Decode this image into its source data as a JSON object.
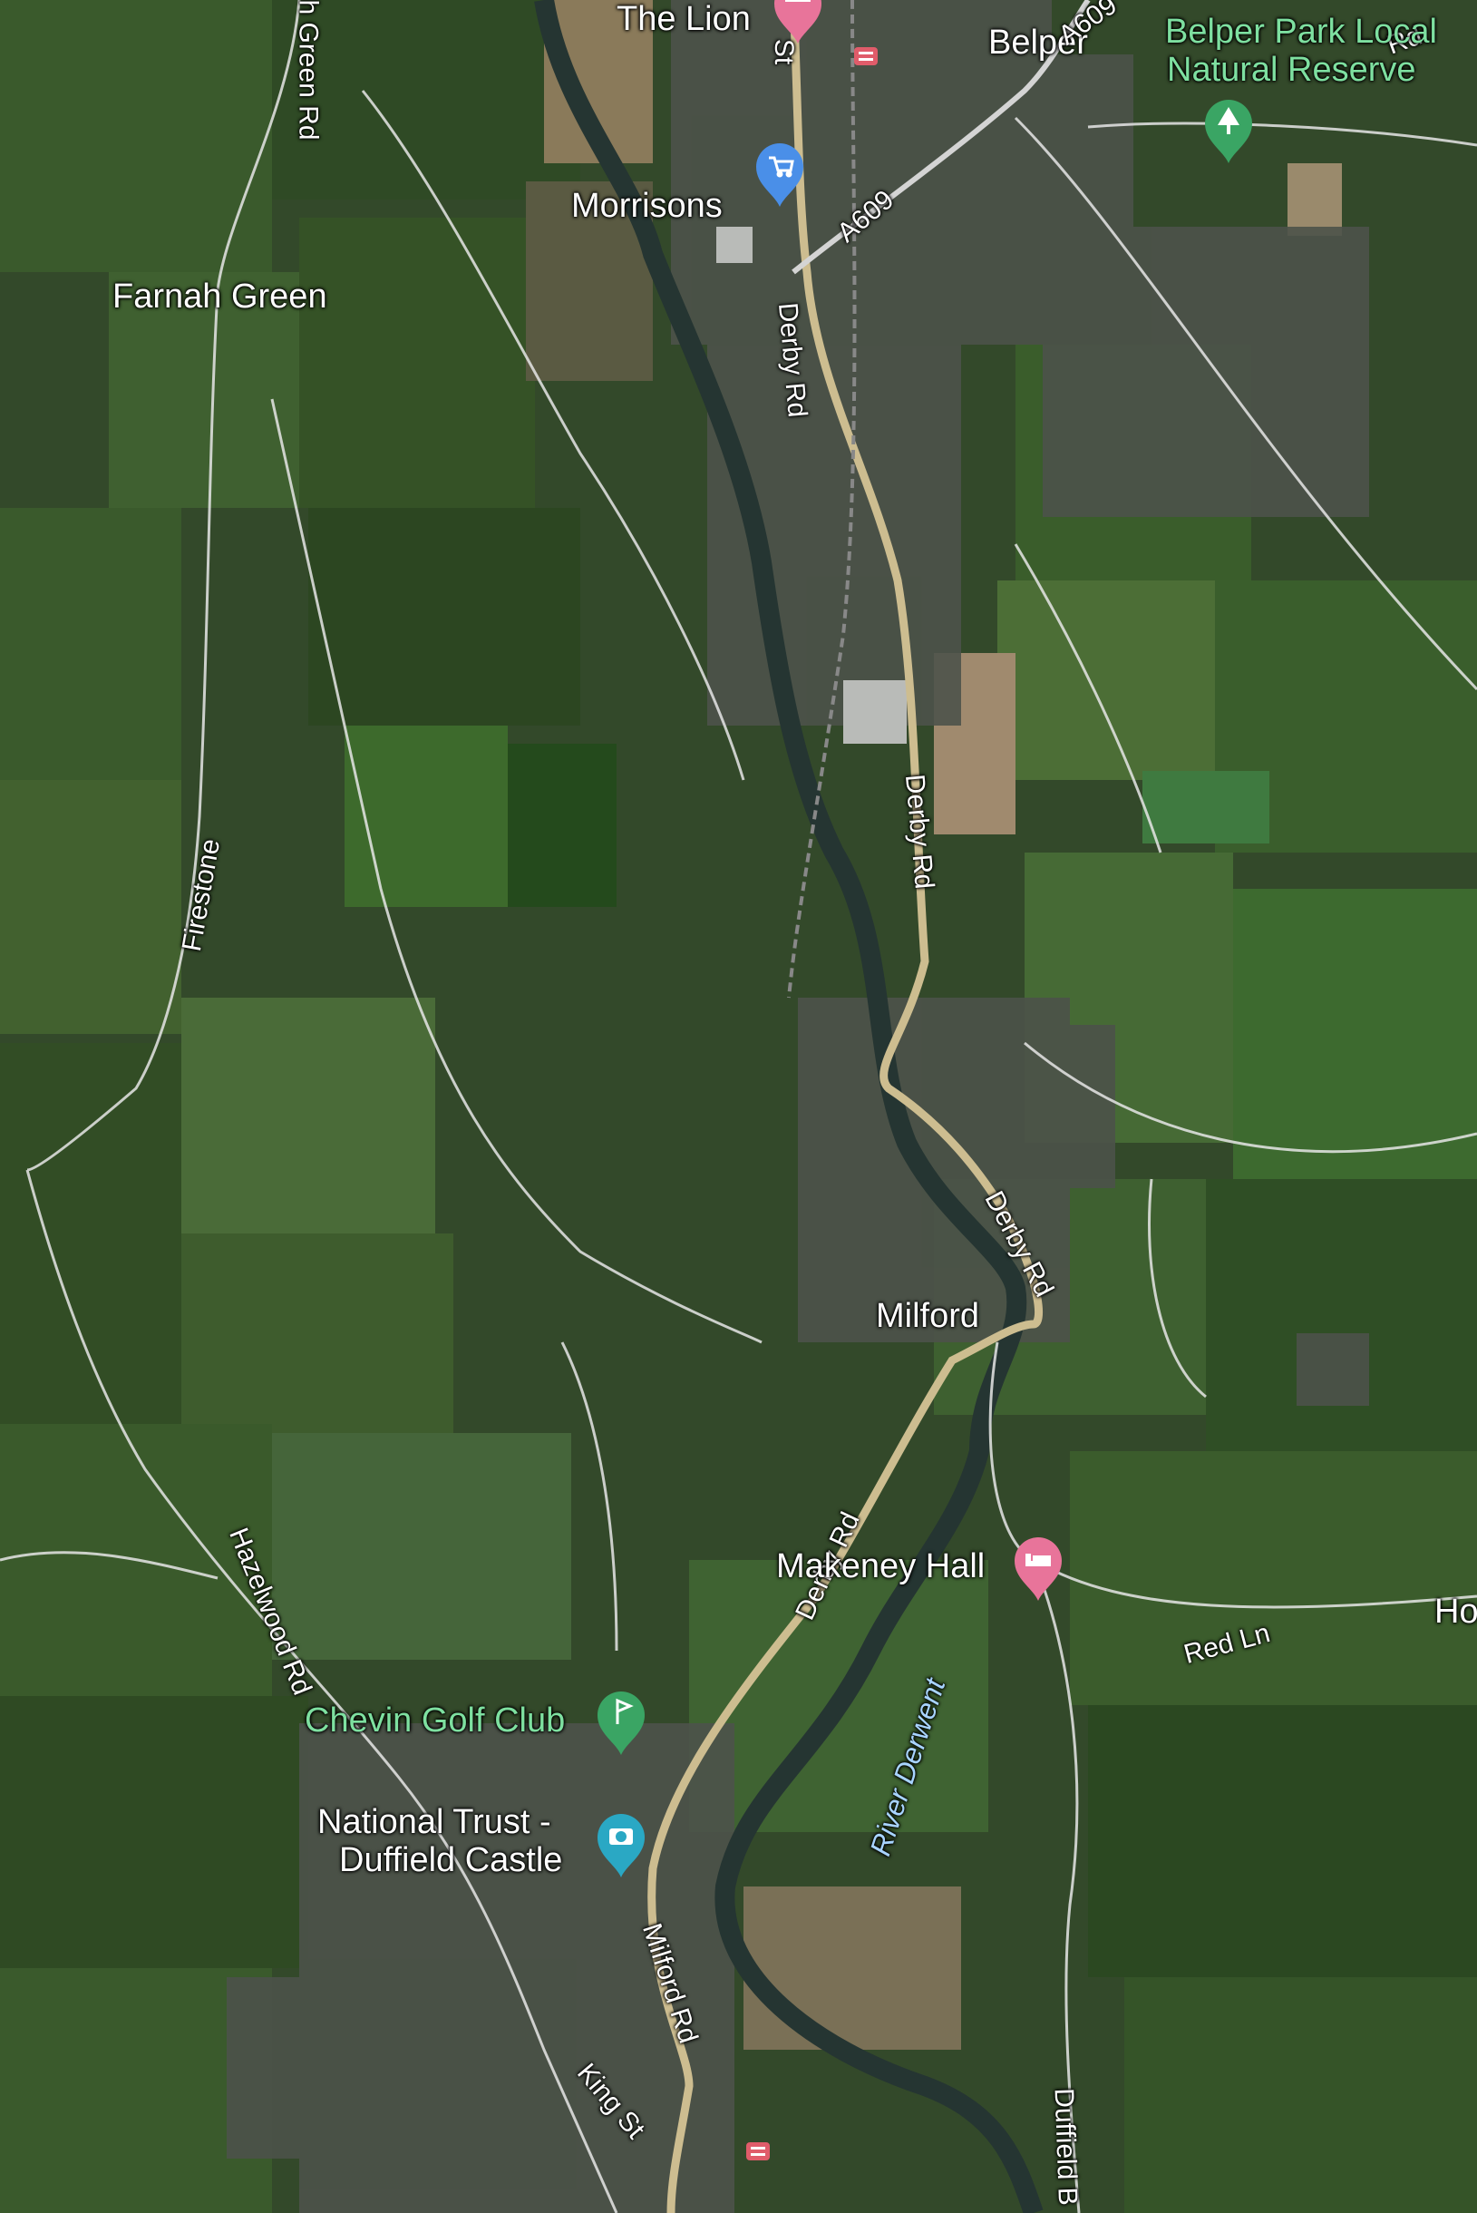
{
  "map": {
    "labels": {
      "the_lion": "The Lion",
      "morrisons": "Morrisons",
      "belper": "Belper",
      "belper_park": "Belper Park Local Natural Reserve",
      "belper_park_line1": "Belper Park Local",
      "belper_park_line2": "Natural Reserve",
      "farnah_green": "Farnah Green",
      "farnah_green_rd": "h Green Rd",
      "a609_1": "A609",
      "a609_2": "A609",
      "derby_rd_1": "Derby Rd",
      "derby_rd_2": "Derby Rd",
      "derby_rd_3": "Derby Rd",
      "derby_rd_4": "Derby Rd",
      "firestone": "Firestone",
      "milford": "Milford",
      "makeney_hall": "Makeney Hall",
      "red_ln": "Red Ln",
      "ho": "Ho",
      "hazelwood_rd": "Hazelwood Rd",
      "chevin_golf_club": "Chevin Golf Club",
      "duffield_castle_line1": "National Trust -",
      "duffield_castle_line2": "Duffield Castle",
      "river_derwent": "River Derwent",
      "milford_rd": "Milford Rd",
      "king_st": "King St",
      "duffield_b": "Duffield B",
      "rd_top": "Rd",
      "st_top": "St"
    },
    "colors": {
      "field_dark": "#24331c",
      "field_mid": "#3d5a2c",
      "field_light": "#5a7a3e",
      "road": "#d8c8a0",
      "minor_road": "#e8e8e8",
      "river": "#2a3a36",
      "urban": "#4a4f48",
      "pin_lodging": "#e8749a",
      "pin_shop": "#4a8fe8",
      "pin_park": "#3aa564",
      "pin_attraction": "#2aa8c4"
    },
    "icons": {
      "lodging": "bed-icon",
      "shopping": "shopping-cart-icon",
      "park": "tree-icon",
      "golf": "golf-icon",
      "attraction": "camera-icon",
      "rail": "rail-station-icon"
    }
  }
}
